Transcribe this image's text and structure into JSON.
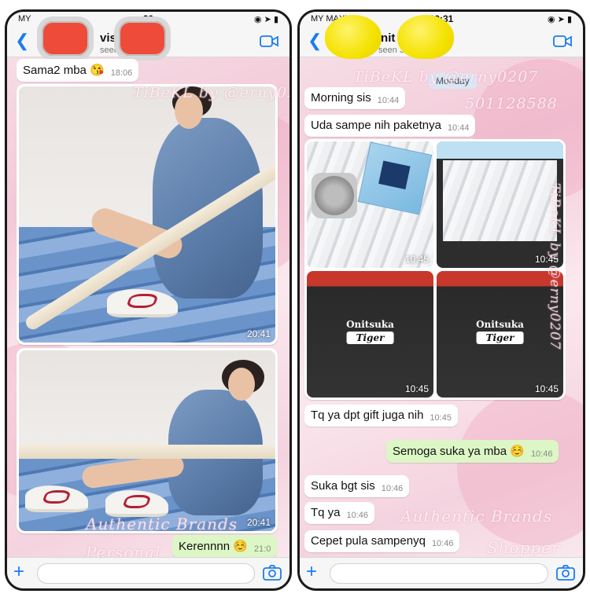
{
  "left_chat": {
    "status": {
      "carrier": "MY",
      "time": "30"
    },
    "contact": {
      "name": "vis",
      "status": "seen 24"
    },
    "messages": [
      {
        "text": "Sama2 mba 😘",
        "time": "18:06"
      },
      {
        "photo_time": "20:41"
      },
      {
        "photo_time": "20:41"
      },
      {
        "text": "Kerennnn ☺️",
        "time": "21:0"
      }
    ],
    "watermarks": [
      "TiBeKL by @erny0207",
      "Authentic Brands",
      "Personal"
    ]
  },
  "right_chat": {
    "status": {
      "carrier": "MY MAXIS",
      "time": "10:31"
    },
    "contact": {
      "name": "t A nit",
      "status": "seen 30"
    },
    "day_label": "Monday",
    "messages": [
      {
        "text": "Morning sis",
        "time": "10:44"
      },
      {
        "text": "Uda sampe nih paketnya",
        "time": "10:44"
      },
      {
        "photos": [
          "10:45",
          "10:45",
          "10:45",
          "10:45"
        ]
      },
      {
        "text": "Tq ya dpt gift juga nih",
        "time": "10:45"
      },
      {
        "text": "Semoga suka ya mba ☺️",
        "time": "10:46"
      },
      {
        "text": "Suka bgt sis",
        "time": "10:46"
      },
      {
        "text": "Tq ya",
        "time": "10:46"
      },
      {
        "text": "Cepet pula sampenyq",
        "time": "10:46"
      }
    ],
    "brand": {
      "name": "Onitsuka",
      "tag": "Tiger"
    },
    "watermarks": [
      "TiBeKL by @erny0207",
      "501128588",
      "TiBeKL by @erny0207",
      "Authentic Brands",
      "Shopper"
    ]
  },
  "colors": {
    "accent": "#1a7cf5",
    "outgoing": "#dcf7c5",
    "incoming": "#ffffff"
  }
}
